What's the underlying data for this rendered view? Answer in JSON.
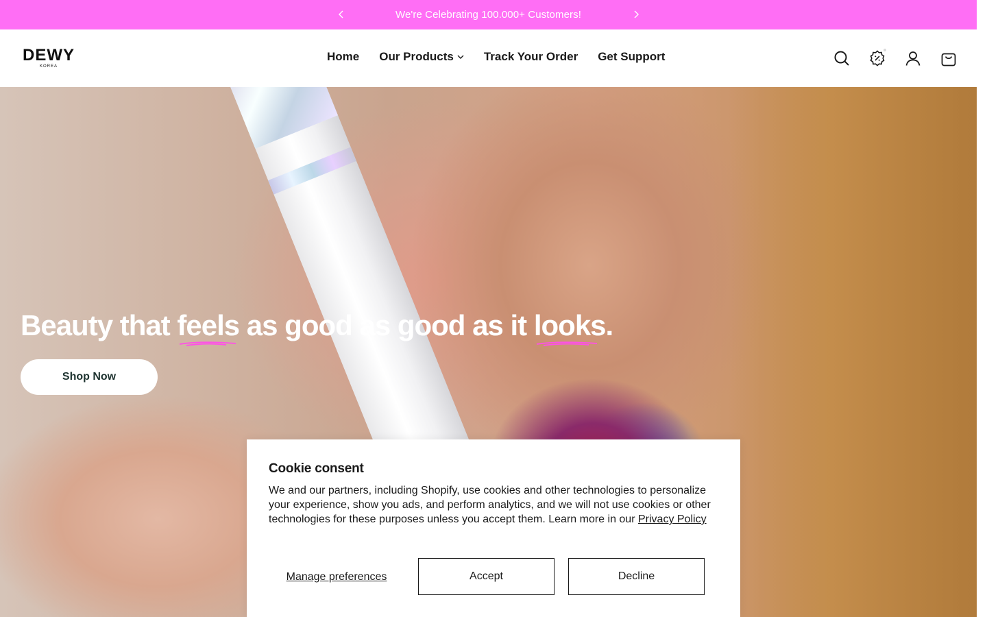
{
  "announcement": {
    "message": "We're Celebrating 100.000+ Customers!",
    "prev_icon": "chevron-left-icon",
    "next_icon": "chevron-right-icon",
    "background": "#ff6ef5"
  },
  "header": {
    "logo_text": "DEWY",
    "logo_subtext": "KOREA",
    "nav": [
      {
        "label": "Home"
      },
      {
        "label": "Our Products",
        "has_dropdown": true
      },
      {
        "label": "Track Your Order"
      },
      {
        "label": "Get Support"
      }
    ],
    "icons": [
      "search-icon",
      "discount-badge-icon",
      "account-icon",
      "cart-icon"
    ]
  },
  "hero": {
    "headline_parts": [
      "Beauty that ",
      "feels",
      " as good as good as it ",
      "looks",
      "."
    ],
    "underline_color": "#ff4fe8",
    "cta_label": "Shop Now"
  },
  "cookie": {
    "title": "Cookie consent",
    "body": "We and our partners, including Shopify, use cookies and other technologies to personalize your experience, show you ads, and perform analytics, and we will not use cookies or other technologies for these purposes unless you accept them. Learn more in our ",
    "privacy_link": "Privacy Policy",
    "manage_label": "Manage preferences",
    "accept_label": "Accept",
    "decline_label": "Decline"
  }
}
